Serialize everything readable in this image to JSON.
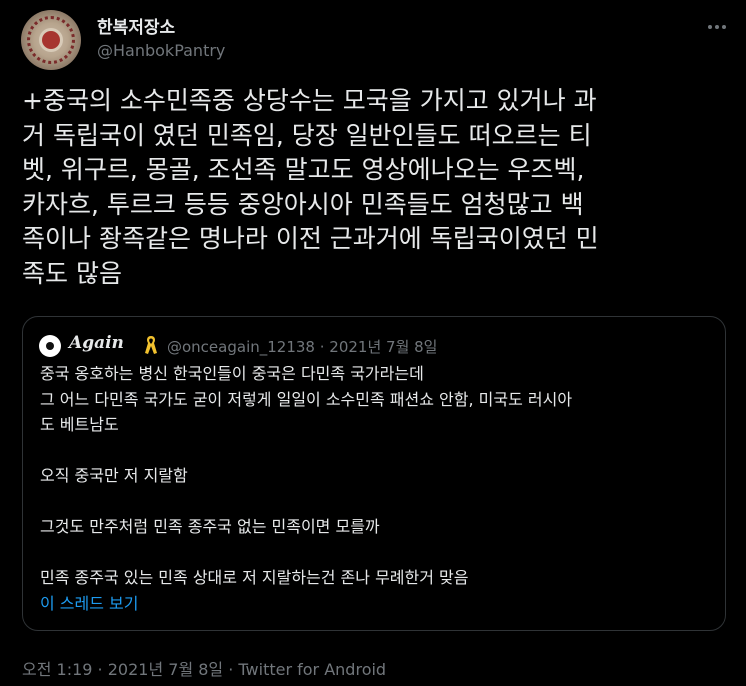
{
  "author": {
    "display_name": "한복저장소",
    "handle": "@HanbokPantry"
  },
  "tweet": {
    "text": "+중국의 소수민족중 상당수는 모국을 가지고 있거나 과\n거 독립국이 였던 민족임, 당장 일반인들도 떠오르는 티\n벳, 위구르, 몽골, 조선족 말고도 영상에나오는 우즈벡,\n카자흐, 투르크 등등 중앙아시아 민족들도 엄청많고 백\n족이나 좡족같은 명나라 이전 근과거에 독립국이였던 민\n족도 많음",
    "time": "오전 1:19",
    "separator_1": " · ",
    "date": "2021년 7월 8일",
    "separator_2": " · ",
    "source": "Twitter for Android"
  },
  "quoted_tweet": {
    "display_name": "Again",
    "handle": "@onceagain_12138",
    "separator": " · ",
    "date": "2021년 7월 8일",
    "text": "중국 옹호하는 병신 한국인들이 중국은 다민족 국가라는데\n그 어느 다민족 국가도 굳이 저렇게 일일이 소수민족 패션쇼 안함, 미국도 러시아\n도 베트남도\n\n오직 중국만 저 지랄함\n\n그것도 만주처럼 민족 종주국 없는 민족이면 모를까\n\n민족 종주국 있는 민족 상대로 저 지랄하는건 존나 무례한거 맞음",
    "show_thread_label": "이 스레드 보기"
  },
  "icons": {
    "more": "more-dots-icon",
    "ribbon": "yellow-ribbon-icon"
  },
  "colors": {
    "background": "#000000",
    "text_primary": "#e7e9ea",
    "text_secondary": "#71767b",
    "link": "#1d9bf0",
    "border": "#2f3336",
    "ribbon": "#f2c12e"
  }
}
